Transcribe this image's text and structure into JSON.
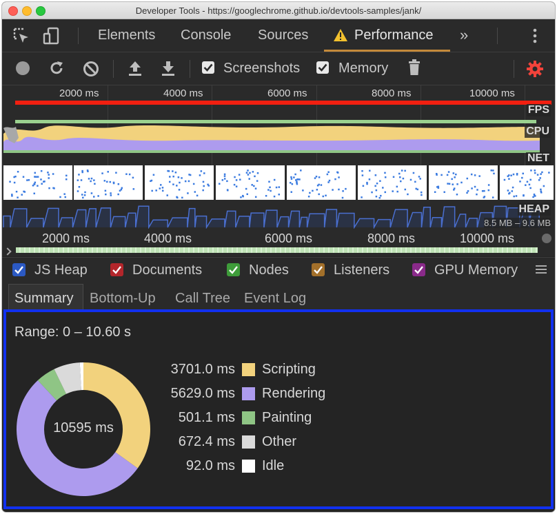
{
  "window": {
    "title": "Developer Tools - https://googlechrome.github.io/devtools-samples/jank/"
  },
  "tabs": [
    {
      "label": "Elements"
    },
    {
      "label": "Console"
    },
    {
      "label": "Sources"
    },
    {
      "label": "Performance",
      "warning": true,
      "active": true
    }
  ],
  "tabs_more": "»",
  "toolbar": {
    "screenshots_label": "Screenshots",
    "screenshots_checked": true,
    "memory_label": "Memory",
    "memory_checked": true
  },
  "overview": {
    "ticks": [
      "2000 ms",
      "4000 ms",
      "6000 ms",
      "8000 ms",
      "10000 ms"
    ],
    "track_labels": {
      "fps": "FPS",
      "cpu": "CPU",
      "net": "NET",
      "heap": "HEAP"
    },
    "heap_range": "8.5 MB – 9.6 MB",
    "lower_ticks": [
      "2000 ms",
      "4000 ms",
      "6000 ms",
      "8000 ms",
      "10000 ms"
    ]
  },
  "legend": [
    {
      "label": "JS Heap",
      "color": "#2b59c3",
      "checked": true
    },
    {
      "label": "Documents",
      "color": "#b3262b",
      "checked": true
    },
    {
      "label": "Nodes",
      "color": "#3e9c3a",
      "checked": true
    },
    {
      "label": "Listeners",
      "color": "#a3702a",
      "checked": true
    },
    {
      "label": "GPU Memory",
      "color": "#8a2a8a",
      "checked": true
    }
  ],
  "subtabs": [
    {
      "label": "Summary",
      "active": true
    },
    {
      "label": "Bottom-Up"
    },
    {
      "label": "Call Tree"
    },
    {
      "label": "Event Log"
    }
  ],
  "summary": {
    "range": "Range: 0 – 10.60 s",
    "total": "10595 ms"
  },
  "chart_data": {
    "type": "pie",
    "categories": [
      "Scripting",
      "Rendering",
      "Painting",
      "Other",
      "Idle"
    ],
    "values": [
      3701.0,
      5629.0,
      501.1,
      672.4,
      92.0
    ],
    "value_labels": [
      "3701.0 ms",
      "5629.0 ms",
      "501.1 ms",
      "672.4 ms",
      "92.0 ms"
    ],
    "colors": [
      "#f2d27d",
      "#ad9bee",
      "#8fc585",
      "#dadada",
      "#ffffff"
    ],
    "center_label": "10595 ms"
  }
}
